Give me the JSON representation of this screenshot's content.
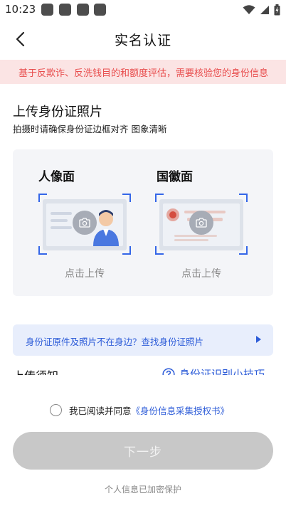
{
  "status_bar": {
    "time": "10:23",
    "app_icons": [
      "notification-square-icon",
      "notification-square-icon",
      "notification-square-icon",
      "notification-square-icon"
    ],
    "indicators": [
      "wifi-icon",
      "signal-icon",
      "battery-icon"
    ]
  },
  "nav": {
    "title": "实名认证"
  },
  "notice": {
    "text": "基于反欺诈、反洗钱目的和额度评估，需要核验您的身份信息"
  },
  "upload": {
    "title": "上传身份证照片",
    "subtitle": "拍摄时请确保身份证边框对齐 图象清晰",
    "portrait": {
      "label": "人像面",
      "hint": "点击上传"
    },
    "emblem": {
      "label": "国徽面",
      "hint": "点击上传"
    }
  },
  "tip_banner": {
    "text": "身份证原件及照片不在身边？查找身份证照片"
  },
  "notes": {
    "label": "上传须知",
    "tips_link": "身份证识别小技巧"
  },
  "agreement": {
    "prefix": "我已阅读并同意",
    "link": "《身份信息采集授权书》"
  },
  "next_button": {
    "label": "下一步"
  },
  "footer": {
    "text": "个人信息已加密保护"
  },
  "colors": {
    "accent": "#2d5cd8",
    "frame": "#3466e8",
    "notice_bg": "#fbe4e4",
    "notice_text": "#e84c4c",
    "disabled_button": "#c8c8c8"
  }
}
